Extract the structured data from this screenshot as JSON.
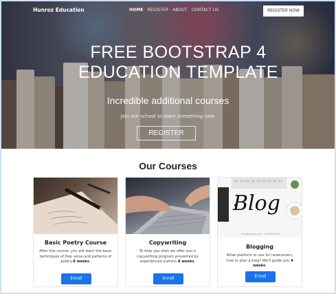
{
  "nav": {
    "brand": "Hunroz Education",
    "links": [
      "HOME",
      "REGISTER",
      "ABOUT",
      "CONTACT US"
    ],
    "cta": "REGISTER NOW"
  },
  "hero": {
    "title_line1": "FREE BOOTSTRAP 4",
    "title_line2": "EDUCATION TEMPLATE",
    "subtitle": "Incredible additional courses",
    "description": "Join our school to learn something new.",
    "button": "REGISTER"
  },
  "courses": {
    "heading": "Our Courses",
    "items": [
      {
        "title": "Basic Poetry Course",
        "text": "After this course, you will learn the basic techniques of free verse and patterns of poetry.",
        "duration": "8 weeks",
        "button": "Enroll"
      },
      {
        "title": "Copywriting",
        "text": "To help you start we offer you a copywriting program presented by experienced authors.",
        "duration": "8 weeks",
        "button": "Enroll"
      },
      {
        "title": "Blogging",
        "text": "What platform to use for newcomers, how to plan a blog? We'll guide you",
        "duration": "4 weeks",
        "button": "Enroll"
      }
    ],
    "blog_image_word": "Blog",
    "blog_image_credit": "shutterstock.com · 1060958416"
  },
  "colors": {
    "accent": "#1a73e8",
    "frame": "#cfe0f7"
  }
}
